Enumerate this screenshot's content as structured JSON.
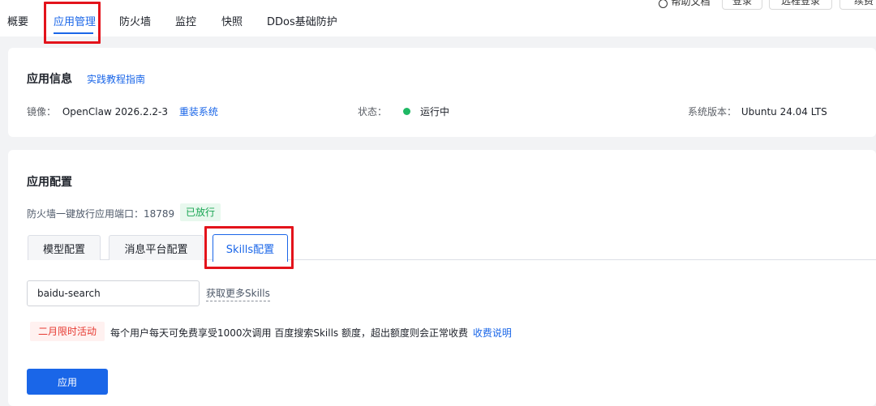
{
  "nav": {
    "tabs": [
      {
        "label": "概要"
      },
      {
        "label": "应用管理",
        "active": true
      },
      {
        "label": "防火墙"
      },
      {
        "label": "监控"
      },
      {
        "label": "快照"
      },
      {
        "label": "DDos基础防护"
      }
    ],
    "top_buttons": [
      "帮助文档",
      "登录",
      "远程登录",
      "续费"
    ]
  },
  "app_info": {
    "title": "应用信息",
    "guide_link": "实践教程指南",
    "image_label": "镜像：",
    "image_value": "OpenClaw 2026.2.2-3",
    "reinstall_link": "重装系统",
    "status_label": "状态：",
    "status_value": "运行中",
    "os_label": "系统版本：",
    "os_value": "Ubuntu 24.04 LTS"
  },
  "app_config": {
    "title": "应用配置",
    "port_text": "防火墙一键放行应用端口：18789",
    "port_badge": "已放行",
    "tabs": [
      {
        "label": "模型配置"
      },
      {
        "label": "消息平台配置"
      },
      {
        "label": "Skills配置",
        "active": true
      }
    ],
    "skill_input_value": "baidu-search",
    "more_skills_link": "获取更多Skills",
    "promo_badge": "二月限时活动",
    "promo_text": "每个用户每天可免费享受1000次调用 百度搜索Skills 额度，超出额度则会正常收费",
    "fee_link": "收费说明",
    "apply_button": "应用"
  },
  "colors": {
    "accent": "#1a66e8",
    "highlight_box": "#e3131b",
    "status_running": "#1fb864"
  }
}
